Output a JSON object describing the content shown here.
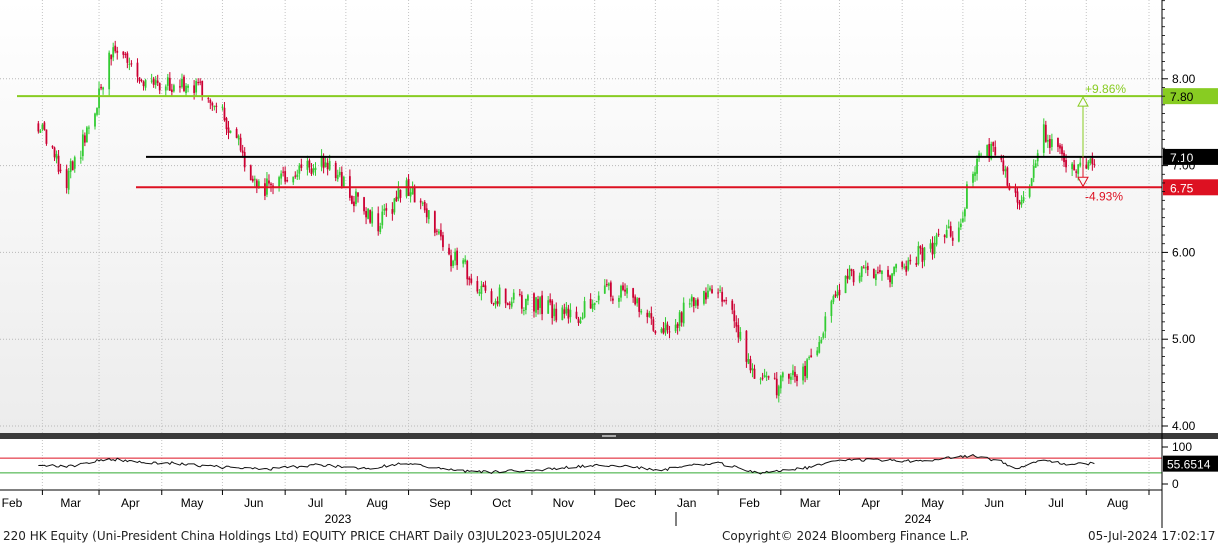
{
  "chart_data": {
    "type": "candlestick",
    "date_range": [
      "2023-01-30",
      "2024-07-05"
    ],
    "x_tick_labels": [
      "Feb",
      "Mar",
      "Apr",
      "May",
      "Jun",
      "Jul",
      "Aug",
      "Sep",
      "Oct",
      "Nov",
      "Dec",
      "Jan",
      "Feb",
      "Mar",
      "Apr",
      "May",
      "Jun",
      "Jul",
      "Aug"
    ],
    "x_year_labels": [
      "2023",
      "2024"
    ],
    "y_ticks": [
      4.0,
      5.0,
      6.0,
      7.0,
      8.0
    ],
    "y_tick_labels": [
      "4.00",
      "5.00",
      "6.00",
      "7.00",
      "8.00"
    ],
    "ylim": [
      3.9,
      9.0
    ],
    "up_color": "#33cc33",
    "down_color": "#cc0033",
    "series": {
      "close_anchors": [
        [
          "2023-01-30",
          7.5
        ],
        [
          "2023-02-06",
          7.1
        ],
        [
          "2023-02-13",
          6.85
        ],
        [
          "2023-02-20",
          7.2
        ],
        [
          "2023-02-27",
          7.6
        ],
        [
          "2023-03-06",
          8.3
        ],
        [
          "2023-03-13",
          8.35
        ],
        [
          "2023-03-20",
          8.05
        ],
        [
          "2023-03-27",
          7.95
        ],
        [
          "2023-04-10",
          7.9
        ],
        [
          "2023-04-24",
          7.85
        ],
        [
          "2023-05-01",
          7.6
        ],
        [
          "2023-05-08",
          7.3
        ],
        [
          "2023-05-15",
          6.9
        ],
        [
          "2023-05-22",
          6.75
        ],
        [
          "2023-06-05",
          6.9
        ],
        [
          "2023-06-19",
          7.05
        ],
        [
          "2023-07-03",
          6.7
        ],
        [
          "2023-07-10",
          6.45
        ],
        [
          "2023-07-17",
          6.3
        ],
        [
          "2023-07-24",
          6.55
        ],
        [
          "2023-07-31",
          6.75
        ],
        [
          "2023-08-07",
          6.5
        ],
        [
          "2023-08-14",
          6.3
        ],
        [
          "2023-08-21",
          5.95
        ],
        [
          "2023-08-28",
          5.85
        ],
        [
          "2023-09-04",
          5.65
        ],
        [
          "2023-09-11",
          5.5
        ],
        [
          "2023-09-25",
          5.45
        ],
        [
          "2023-10-09",
          5.35
        ],
        [
          "2023-10-23",
          5.25
        ],
        [
          "2023-11-06",
          5.55
        ],
        [
          "2023-11-20",
          5.5
        ],
        [
          "2023-11-27",
          5.3
        ],
        [
          "2023-12-04",
          5.05
        ],
        [
          "2023-12-11",
          5.2
        ],
        [
          "2023-12-18",
          5.4
        ],
        [
          "2024-01-01",
          5.6
        ],
        [
          "2024-01-08",
          5.35
        ],
        [
          "2024-01-15",
          4.75
        ],
        [
          "2024-01-22",
          4.55
        ],
        [
          "2024-01-29",
          4.45
        ],
        [
          "2024-02-05",
          4.55
        ],
        [
          "2024-02-12",
          4.65
        ],
        [
          "2024-02-19",
          4.85
        ],
        [
          "2024-02-26",
          5.4
        ],
        [
          "2024-03-04",
          5.75
        ],
        [
          "2024-03-11",
          5.75
        ],
        [
          "2024-03-25",
          5.75
        ],
        [
          "2024-04-08",
          5.95
        ],
        [
          "2024-04-22",
          6.15
        ],
        [
          "2024-04-29",
          6.3
        ],
        [
          "2024-05-06",
          7.0
        ],
        [
          "2024-05-13",
          7.2
        ],
        [
          "2024-05-20",
          7.05
        ],
        [
          "2024-05-27",
          6.6
        ],
        [
          "2024-06-03",
          6.75
        ],
        [
          "2024-06-10",
          7.4
        ],
        [
          "2024-06-17",
          7.15
        ],
        [
          "2024-06-24",
          7.0
        ],
        [
          "2024-07-05",
          7.1
        ]
      ]
    },
    "horizontal_lines": [
      {
        "name": "upper-target",
        "value": 7.8,
        "label": "7.80",
        "color": "#88cc22",
        "annotation": "+9.86%"
      },
      {
        "name": "last-price",
        "value": 7.1,
        "label": "7.10",
        "color": "#000000"
      },
      {
        "name": "lower-target",
        "value": 6.75,
        "label": "6.75",
        "color": "#dd1122",
        "annotation": "-4.93%"
      }
    ],
    "oscillator": {
      "ylim": [
        0,
        100
      ],
      "y_ticks": [
        0,
        100
      ],
      "y_tick_labels": [
        "0",
        "100"
      ],
      "upper_band": 70,
      "lower_band": 30,
      "last_value_label": "55.6514",
      "anchors": [
        [
          "2023-01-30",
          54
        ],
        [
          "2023-02-13",
          45
        ],
        [
          "2023-02-27",
          62
        ],
        [
          "2023-03-06",
          68
        ],
        [
          "2023-03-20",
          60
        ],
        [
          "2023-04-10",
          55
        ],
        [
          "2023-05-01",
          45
        ],
        [
          "2023-05-22",
          40
        ],
        [
          "2023-06-19",
          52
        ],
        [
          "2023-07-10",
          42
        ],
        [
          "2023-07-31",
          56
        ],
        [
          "2023-08-21",
          38
        ],
        [
          "2023-09-11",
          32
        ],
        [
          "2023-10-09",
          40
        ],
        [
          "2023-11-06",
          52
        ],
        [
          "2023-12-04",
          38
        ],
        [
          "2023-12-18",
          50
        ],
        [
          "2024-01-01",
          56
        ],
        [
          "2024-01-22",
          30
        ],
        [
          "2024-02-12",
          42
        ],
        [
          "2024-03-04",
          66
        ],
        [
          "2024-04-08",
          62
        ],
        [
          "2024-05-06",
          76
        ],
        [
          "2024-05-20",
          62
        ],
        [
          "2024-05-27",
          40
        ],
        [
          "2024-06-10",
          64
        ],
        [
          "2024-06-24",
          52
        ],
        [
          "2024-07-05",
          56
        ]
      ]
    }
  },
  "footer": {
    "left": "220 HK Equity (Uni-President China Holdings Ltd) EQUITY PRICE CHART  Daily 03JUL2023-05JUL2024",
    "center": "Copyright© 2024 Bloomberg Finance L.P.",
    "right": "05-Jul-2024 17:02:17"
  }
}
